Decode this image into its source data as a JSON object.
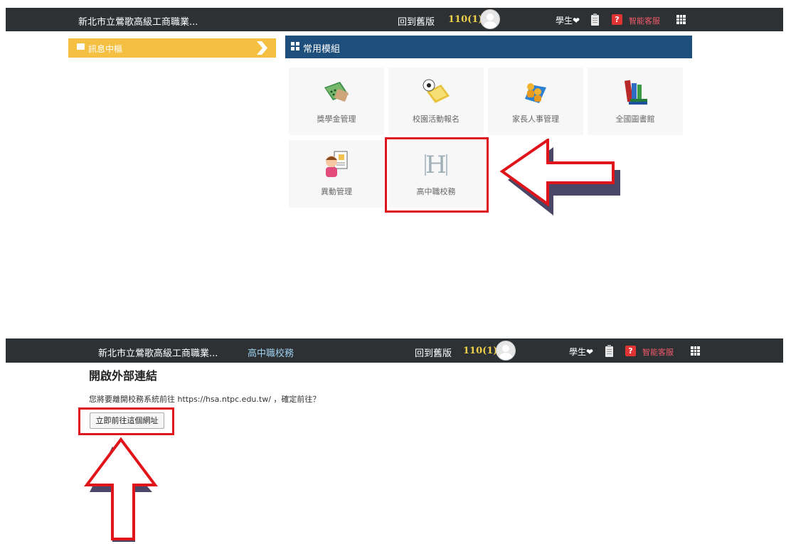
{
  "top": {
    "navbar": {
      "school_name": "新北市立鶯歌高級工商職業...",
      "back_old": "回到舊版",
      "count": "110(1)",
      "role": "學生",
      "service": "智能客服"
    },
    "message_center": "訊息中樞",
    "modules_title": "常用模組",
    "modules": [
      {
        "label": "獎學金管理",
        "icon": "scholarship-icon"
      },
      {
        "label": "校園活動報名",
        "icon": "activity-icon"
      },
      {
        "label": "家長人事管理",
        "icon": "parents-icon"
      },
      {
        "label": "全國圖書館",
        "icon": "library-icon"
      },
      {
        "label": "異動管理",
        "icon": "change-icon"
      },
      {
        "label": "高中職校務",
        "icon": "school-affairs-icon"
      }
    ]
  },
  "bottom": {
    "navbar": {
      "school_name": "新北市立鶯歌高級工商職業...",
      "module": "高中職校務",
      "back_old": "回到舊版",
      "count": "110(1)",
      "role": "學生",
      "service": "智能客服"
    },
    "title": "開啟外部連結",
    "message": "您將要離開校務系統前往 https://hsa.ntpc.edu.tw/ ，確定前往？",
    "button": "立即前往這個網址"
  },
  "colors": {
    "navbar": "#2d3133",
    "message_bar": "#f5c042",
    "module_bar": "#1e4f7c",
    "highlight": "#e0141b",
    "count": "#f0d04a"
  }
}
